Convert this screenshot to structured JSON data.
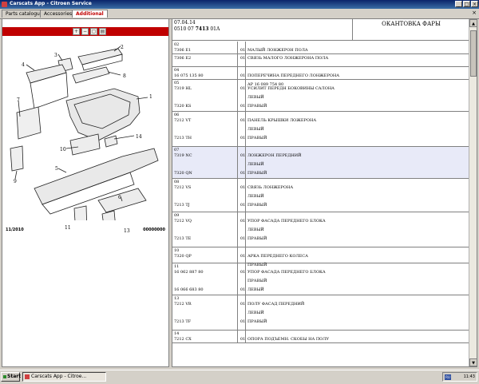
{
  "window": {
    "title": "Carscats App - Citroen Service",
    "minimize": "_",
    "maximize": "□",
    "close": "×"
  },
  "tabs": [
    {
      "label": "Parts catalogue"
    },
    {
      "label": "Accessories"
    },
    {
      "label": "Additional"
    }
  ],
  "tab_close": "×",
  "diagram": {
    "callouts": [
      "1",
      "2",
      "3",
      "4",
      "5",
      "6",
      "7",
      "8",
      "9",
      "10",
      "11",
      "13",
      "14"
    ],
    "footer_left": "11/2010",
    "footer_right": "00000000"
  },
  "header": {
    "line1": "07.04.14",
    "line2_a": "0510 07",
    "line2_b": "7413",
    "line2_c": "01A",
    "title": "ОКАНТОВКА ФАРЫ"
  },
  "rows": [
    {
      "group": "02",
      "lines": [
        {
          "ref": "7306 E1",
          "q": "01",
          "d": "МАЛЫЙ ЛОНЖЕРОН ПОЛА"
        }
      ]
    },
    {
      "group": "",
      "lines": [
        {
          "ref": "7306 E2",
          "q": "01",
          "d": "СВЯЗЬ МАЛОГО ЛОНЖЕРОНА ПОЛА"
        }
      ]
    },
    {
      "group": "04",
      "lines": [
        {
          "ref": "16 075 135 80",
          "q": "01",
          "d": "ПОПЕРЕЧИНА ПЕРЕДНЕГО ЛОНЖЕРОНА"
        },
        {
          "ref": "",
          "q": "",
          "d": "AP 16 089 754 80"
        }
      ]
    },
    {
      "group": "05",
      "lines": [
        {
          "ref": "7319 HL",
          "q": "01",
          "d": "УСИЛИТ ПЕРЕДН БОКОВИНЫ САЛОНА"
        },
        {
          "ref": "",
          "q": "",
          "d": "ЛЕВЫЙ"
        },
        {
          "ref": "7320 KS",
          "q": "01",
          "d": "ПРАВЫЙ"
        }
      ]
    },
    {
      "group": "06",
      "lines": [
        {
          "ref": "7212 VT",
          "q": "01",
          "d": "ПАНЕЛЬ КРЫШКИ ЛОЖЕРОНА"
        },
        {
          "ref": "",
          "q": "",
          "d": "ЛЕВЫЙ"
        },
        {
          "ref": "7213 TH",
          "q": "01",
          "d": "ПРАВЫЙ"
        }
      ]
    },
    {
      "group": "07",
      "lines": [
        {
          "ref": "7319 NC",
          "q": "01",
          "d": "ЛОНЖЕРОН ПЕРЕДНИЙ"
        },
        {
          "ref": "",
          "q": "",
          "d": "ЛЕВЫЙ"
        },
        {
          "ref": "7320 QN",
          "q": "01",
          "d": "ПРАВЫЙ"
        }
      ]
    },
    {
      "group": "08",
      "lines": [
        {
          "ref": "7212 VS",
          "q": "01",
          "d": "СВЯЗЬ ЛОНЖЕРОНА"
        },
        {
          "ref": "",
          "q": "",
          "d": "ЛЕВЫЙ"
        },
        {
          "ref": "7213 TJ",
          "q": "01",
          "d": "ПРАВЫЙ"
        }
      ]
    },
    {
      "group": "09",
      "lines": [
        {
          "ref": "7212 VQ",
          "q": "01",
          "d": "УПОР ФАСАДА ПЕРЕДНЕГО БЛОКА"
        },
        {
          "ref": "",
          "q": "",
          "d": "ЛЕВЫЙ"
        },
        {
          "ref": "7213 TE",
          "q": "01",
          "d": "ПРАВЫЙ"
        }
      ]
    },
    {
      "group": "10",
      "lines": [
        {
          "ref": "7320 QP",
          "q": "01",
          "d": "АРКА ПЕРЕДНЕГО КОЛЕСА"
        },
        {
          "ref": "",
          "q": "",
          "d": "ПРАВЫЙ"
        }
      ]
    },
    {
      "group": "11",
      "lines": [
        {
          "ref": "16 062 887 80",
          "q": "01",
          "d": "УПОР ФАСАДА ПЕРЕДНЕГО БЛОКА"
        },
        {
          "ref": "",
          "q": "",
          "d": "ПРАВЫЙ"
        },
        {
          "ref": "16 066 683 80",
          "q": "01",
          "d": "ЛЕВЫЙ"
        }
      ]
    },
    {
      "group": "13",
      "lines": [
        {
          "ref": "7212 VR",
          "q": "01",
          "d": "ПОЛУ ФАСАД ПЕРЕДНИЙ"
        },
        {
          "ref": "",
          "q": "",
          "d": "ЛЕВЫЙ"
        },
        {
          "ref": "7213 TF",
          "q": "01",
          "d": "ПРАВЫЙ"
        }
      ]
    },
    {
      "group": "14",
      "lines": [
        {
          "ref": "7212 CX",
          "q": "01",
          "d": "ОПОРА ПОДЪЕМН. СКОБЫ НА ПОЛУ"
        }
      ]
    }
  ],
  "taskbar": {
    "start": "Start",
    "task": "Carscats App - Citroe...",
    "lang": "RU",
    "clock": "11:43"
  },
  "colors": {
    "accent": "#c00000",
    "highlight": "#e8eaf8",
    "titlebar": "#0a246a"
  }
}
